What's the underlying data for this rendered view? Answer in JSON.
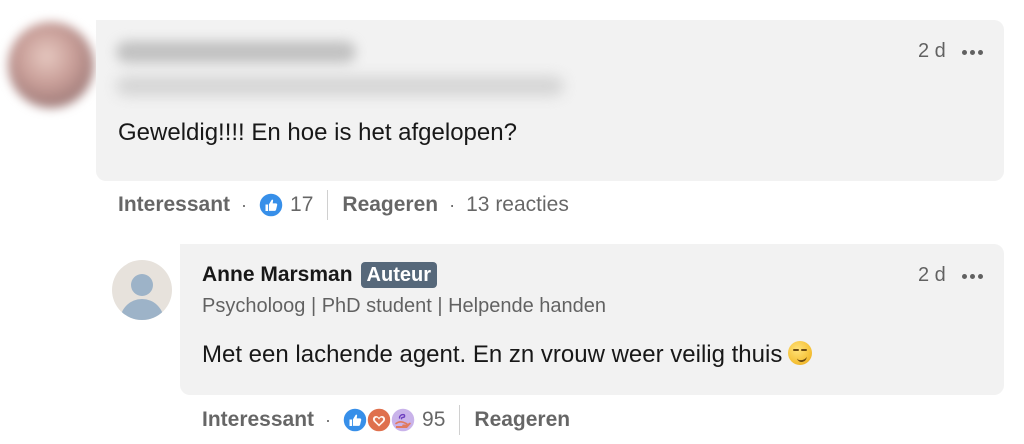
{
  "comment": {
    "time": "2 d",
    "text": "Geweldig!!!! En hoe is het afgelopen?",
    "actions": {
      "like_label": "Interessant",
      "reaction_count": "17",
      "reply_label": "Reageren",
      "replies_count": "13 reacties"
    },
    "reaction_icons": [
      "like-icon"
    ]
  },
  "reply": {
    "author": "Anne Marsman",
    "badge": "Auteur",
    "headline": "Psycholoog | PhD student | Helpende handen",
    "time": "2 d",
    "text": "Met een lachende agent. En zn vrouw weer veilig thuis",
    "emoji": "smirk-emoji",
    "actions": {
      "like_label": "Interessant",
      "reaction_count": "95",
      "reply_label": "Reageren"
    },
    "reaction_icons": [
      "like-icon",
      "love-icon",
      "support-icon"
    ]
  },
  "colors": {
    "bubble": "#f2f2f2",
    "like_blue": "#378fe9",
    "love_red": "#df704d",
    "support_purple": "#a872e8",
    "badge": "#56687a"
  }
}
